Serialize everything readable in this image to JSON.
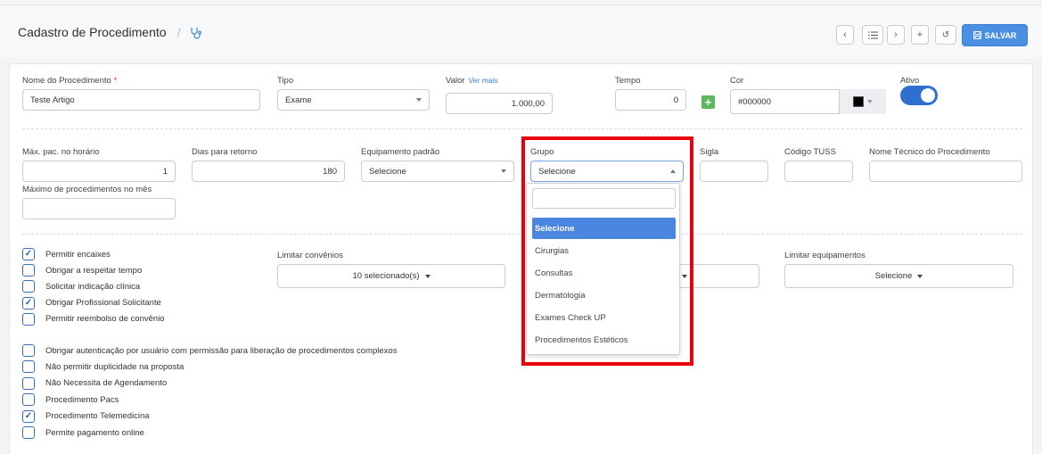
{
  "header": {
    "title": "Cadastro de Procedimento",
    "separator": "/",
    "save_label": "SALVAR"
  },
  "form": {
    "nome_label": "Nome do Procedimento",
    "required_mark": "*",
    "nome_value": "Teste Artigo",
    "tipo_label": "Tipo",
    "tipo_value": "Exame",
    "valor_label": "Valor",
    "valor_link": "Ver mais",
    "valor_value": "1.000,00",
    "tempo_label": "Tempo",
    "tempo_value": "0",
    "cor_label": "Cor",
    "cor_value": "#000000",
    "cor_swatch": "#000000",
    "ativo_label": "Ativo",
    "ativo_on": true,
    "max_pac_label": "Máx. pac. no horário",
    "max_pac_value": "1",
    "dias_retorno_label": "Dias para retorno",
    "dias_retorno_value": "180",
    "equipamento_label": "Equipamento padrão",
    "equipamento_value": "Selecione",
    "grupo_label": "Grupo",
    "grupo_value": "Selecione",
    "sigla_label": "Sigla",
    "tuss_label": "Código TUSS",
    "nome_tecnico_label": "Nome Técnico do Procedimento",
    "max_proc_mes_label": "Máximo de procedimentos no mês",
    "limitar_convenios_label": "Limitar convênios",
    "limitar_convenios_value": "10 selecionado(s)",
    "limitar_equip_label": "Limitar equipamentos",
    "limitar_equip_value": "Selecione"
  },
  "checkboxes_group1": [
    {
      "label": "Permitir encaixes",
      "checked": true
    },
    {
      "label": "Obrigar a respeitar tempo",
      "checked": false
    },
    {
      "label": "Solicitar indicação clínica",
      "checked": false
    },
    {
      "label": "Obrigar Profissional Solicitante",
      "checked": true
    },
    {
      "label": "Permitir reembolso de convênio",
      "checked": false
    }
  ],
  "checkboxes_group2": [
    {
      "label": "Obrigar autenticação por usuário com permissão para liberação de procedimentos complexos",
      "checked": false
    },
    {
      "label": "Não permitir duplicidade na proposta",
      "checked": false
    },
    {
      "label": "Não Necessita de Agendamento",
      "checked": false
    },
    {
      "label": "Procedimento Pacs",
      "checked": false
    },
    {
      "label": "Procedimento Telemedicina",
      "checked": true
    },
    {
      "label": "Permite pagamento online",
      "checked": false
    }
  ],
  "grupo_dropdown": {
    "items": [
      "Selecione",
      "Cirurgias",
      "Consultas",
      "Dermatologia",
      "Exames Check UP",
      "Procedimentos Estéticos"
    ],
    "active_item": "Selecione",
    "highlight_color": "#e8000b"
  },
  "colors": {
    "primary": "#4a90e2",
    "toggle": "#2f6fd0",
    "add": "#5cb85c"
  },
  "check_glyph": "✓"
}
